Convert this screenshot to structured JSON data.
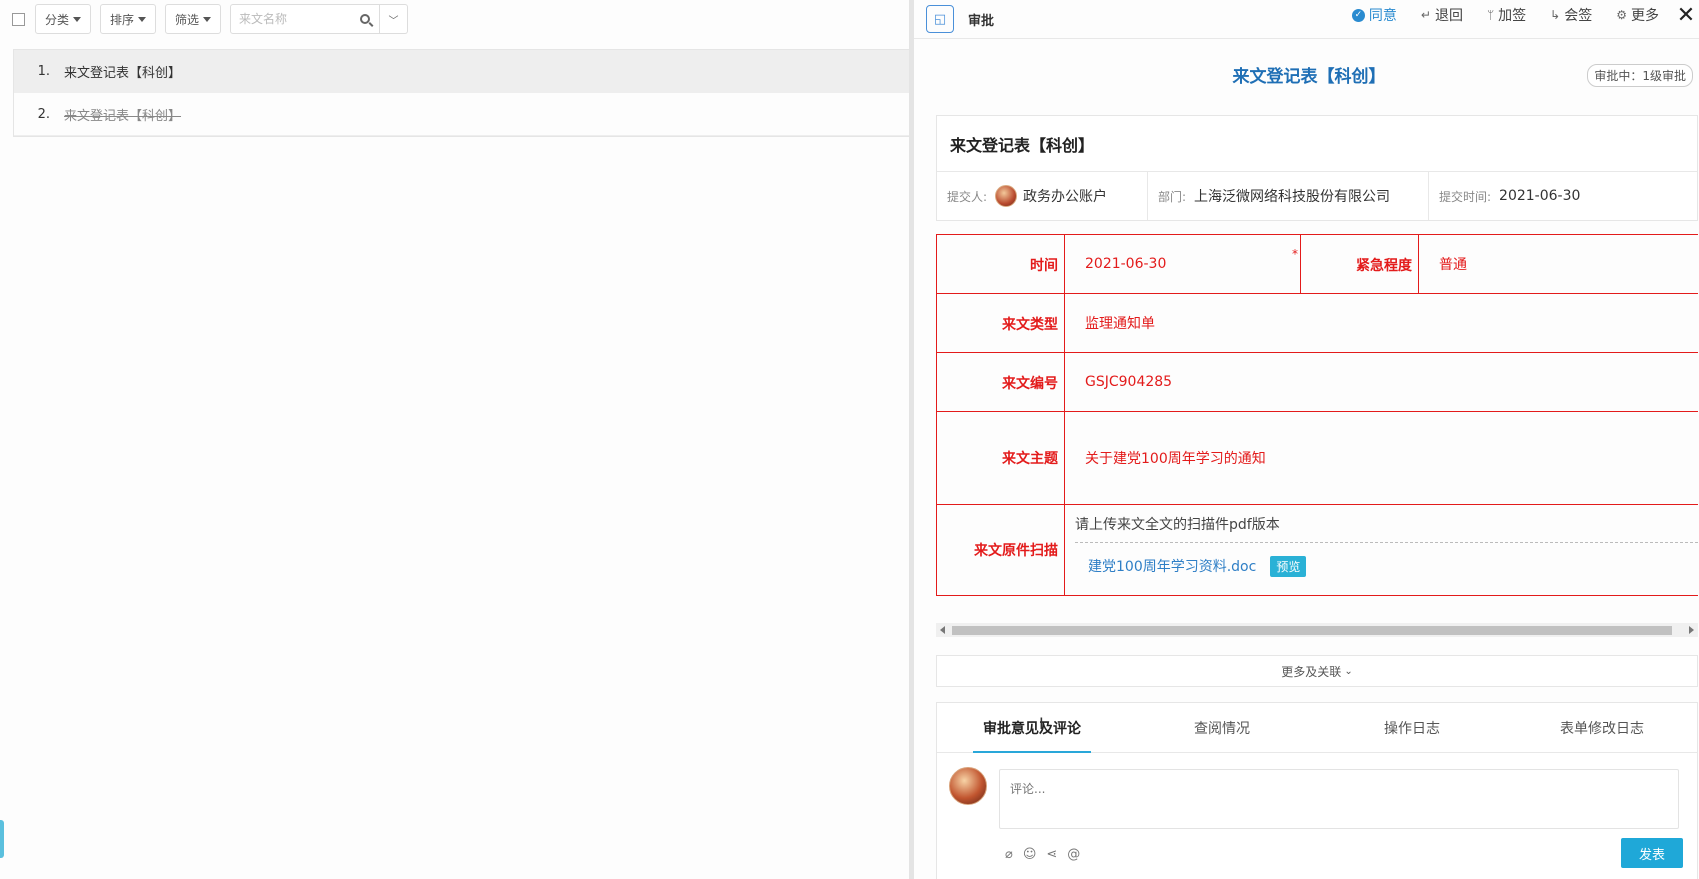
{
  "left": {
    "toolbar": {
      "category_label": "分类",
      "sort_label": "排序",
      "filter_label": "筛选",
      "search_placeholder": "来文名称"
    },
    "items": [
      {
        "num": "1.",
        "title": "来文登记表【科创】",
        "active": true,
        "struck": false
      },
      {
        "num": "2.",
        "title": "来文登记表【科创】",
        "active": false,
        "struck": true
      }
    ]
  },
  "right": {
    "header": {
      "panel_icon": "panel-toggle-icon",
      "title": "审批",
      "actions": {
        "agree": "同意",
        "return": "退回",
        "add_sign": "加签",
        "co_sign": "会签",
        "more": "更多"
      },
      "close": "✕"
    },
    "form_title": "来文登记表【科创】",
    "status": "审批中：1级审批",
    "card": {
      "title": "来文登记表【科创】",
      "submitter_label": "提交人:",
      "submitter": "政务办公账户",
      "dept_label": "部门:",
      "dept": "上海泛微网络科技股份有限公司",
      "time_label": "提交时间:",
      "time": "2021-06-30"
    },
    "form": {
      "time_label": "时间",
      "time_value": "2021-06-30",
      "required_mark": "*",
      "urgency_label": "紧急程度",
      "urgency_value": "普通",
      "type_label": "来文类型",
      "type_value": "监理通知单",
      "number_label": "来文编号",
      "number_value": "GSJC904285",
      "subject_label": "来文主题",
      "subject_value": "关于建党100周年学习的通知",
      "scan_label": "来文原件扫描",
      "scan_hint": "请上传来文全文的扫描件pdf版本",
      "file_name": "建党100周年学习资料.doc",
      "preview_label": "预览"
    },
    "more_label": "更多及关联",
    "tabs": [
      "审批意见及评论",
      "查阅情况",
      "操作日志",
      "表单修改日志"
    ],
    "comment": {
      "placeholder": "评论...",
      "publish_label": "发表"
    }
  },
  "colors": {
    "accent": "#1fa8d8",
    "form_red": "#e31b1b",
    "title_blue": "#1f6fb5"
  }
}
